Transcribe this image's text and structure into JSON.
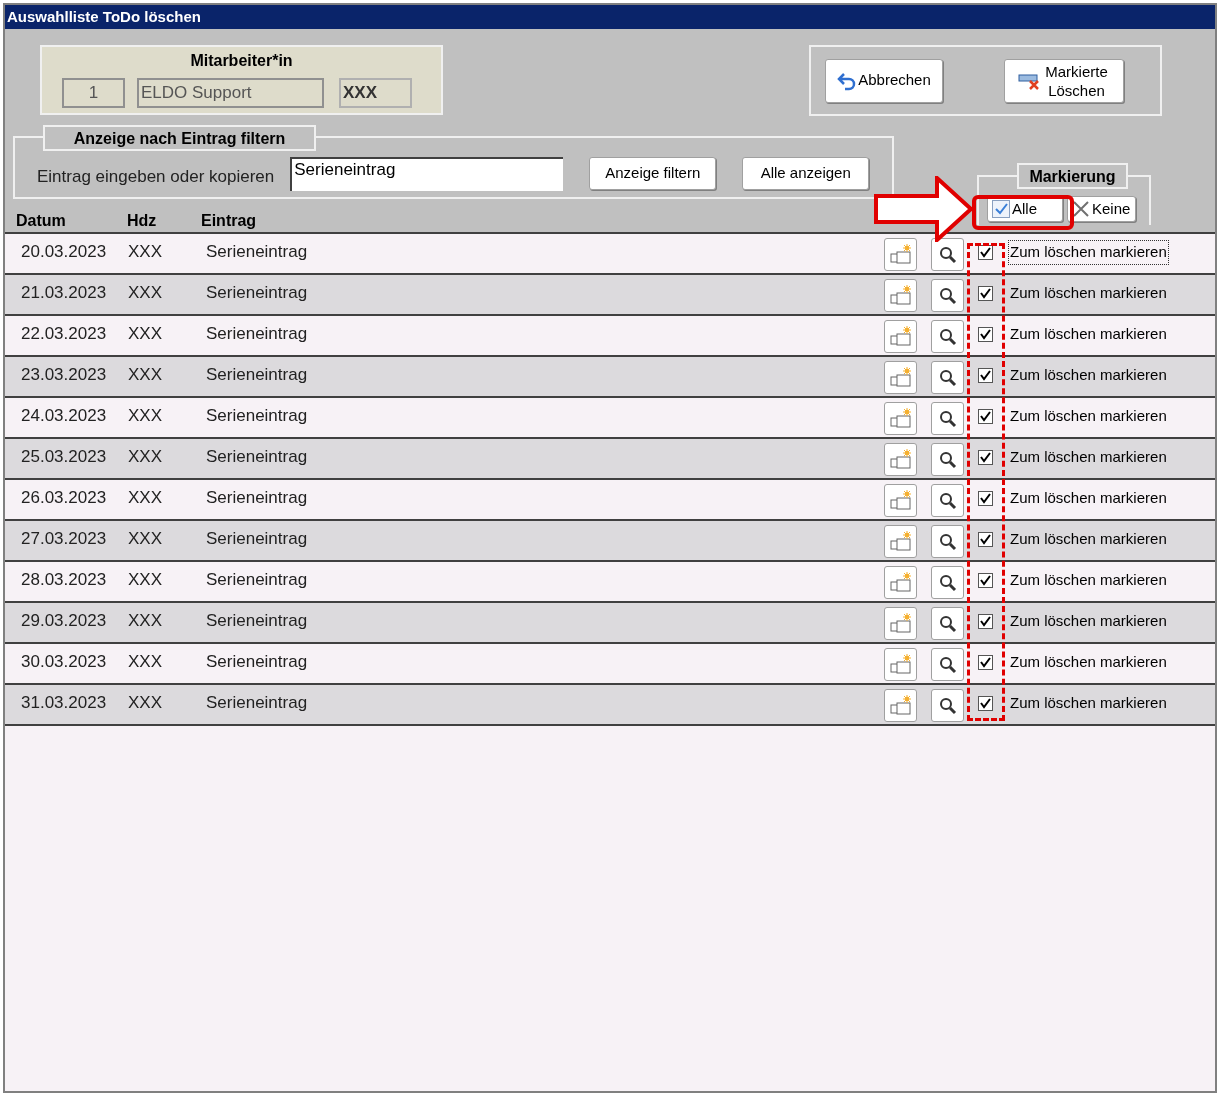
{
  "window": {
    "title": "Auswahlliste ToDo löschen"
  },
  "employee": {
    "heading": "Mitarbeiter*in",
    "number": "1",
    "name": "ELDO Support",
    "code": "XXX"
  },
  "actions": [
    {
      "kind": "cancel",
      "label": "Abbrechen"
    },
    {
      "kind": "delete",
      "label": "Markierte Löschen"
    }
  ],
  "filter": {
    "legend": "Anzeige nach Eintrag filtern",
    "label": "Eintrag eingeben oder kopieren",
    "value": "Serieneintrag",
    "buttons": [
      "Anzeige filtern",
      "Alle anzeigen"
    ]
  },
  "marking": {
    "legend": "Markierung",
    "buttons": [
      {
        "kind": "all",
        "label": "Alle",
        "highlighted": true
      },
      {
        "kind": "none",
        "label": "Keine",
        "highlighted": false
      }
    ]
  },
  "table": {
    "columns": [
      "Datum",
      "Hdz",
      "Eintrag"
    ],
    "rows": [
      {
        "date": "20.03.2023",
        "hdz": "XXX",
        "entry": "Serieneintrag",
        "checked": true,
        "label": "Zum löschen markieren",
        "focused": true
      },
      {
        "date": "21.03.2023",
        "hdz": "XXX",
        "entry": "Serieneintrag",
        "checked": true,
        "label": "Zum löschen markieren",
        "focused": false
      },
      {
        "date": "22.03.2023",
        "hdz": "XXX",
        "entry": "Serieneintrag",
        "checked": true,
        "label": "Zum löschen markieren",
        "focused": false
      },
      {
        "date": "23.03.2023",
        "hdz": "XXX",
        "entry": "Serieneintrag",
        "checked": true,
        "label": "Zum löschen markieren",
        "focused": false
      },
      {
        "date": "24.03.2023",
        "hdz": "XXX",
        "entry": "Serieneintrag",
        "checked": true,
        "label": "Zum löschen markieren",
        "focused": false
      },
      {
        "date": "25.03.2023",
        "hdz": "XXX",
        "entry": "Serieneintrag",
        "checked": true,
        "label": "Zum löschen markieren",
        "focused": false
      },
      {
        "date": "26.03.2023",
        "hdz": "XXX",
        "entry": "Serieneintrag",
        "checked": true,
        "label": "Zum löschen markieren",
        "focused": false
      },
      {
        "date": "27.03.2023",
        "hdz": "XXX",
        "entry": "Serieneintrag",
        "checked": true,
        "label": "Zum löschen markieren",
        "focused": false
      },
      {
        "date": "28.03.2023",
        "hdz": "XXX",
        "entry": "Serieneintrag",
        "checked": true,
        "label": "Zum löschen markieren",
        "focused": false
      },
      {
        "date": "29.03.2023",
        "hdz": "XXX",
        "entry": "Serieneintrag",
        "checked": true,
        "label": "Zum löschen markieren",
        "focused": false
      },
      {
        "date": "30.03.2023",
        "hdz": "XXX",
        "entry": "Serieneintrag",
        "checked": true,
        "label": "Zum löschen markieren",
        "focused": false
      },
      {
        "date": "31.03.2023",
        "hdz": "XXX",
        "entry": "Serieneintrag",
        "checked": true,
        "label": "Zum löschen markieren",
        "focused": false
      }
    ]
  }
}
